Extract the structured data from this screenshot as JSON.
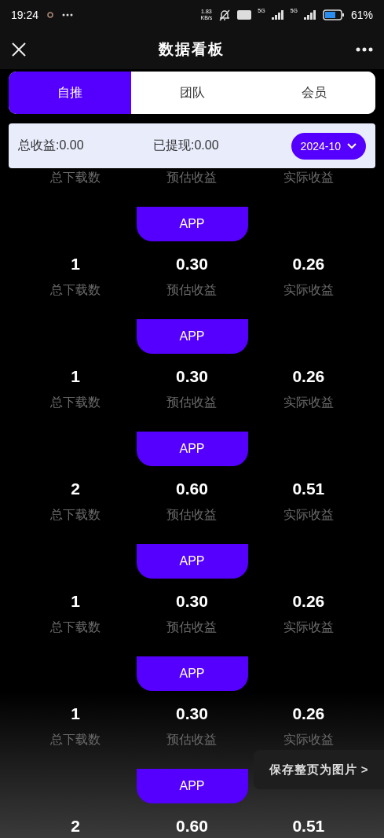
{
  "status_bar": {
    "time": "19:24",
    "speed": "1.83",
    "speed_unit": "KB/s",
    "network_1": "5G",
    "network_2": "5G",
    "battery": "61%"
  },
  "header": {
    "title": "数据看板"
  },
  "tabs": [
    {
      "label": "自推",
      "selected": true
    },
    {
      "label": "团队",
      "selected": false
    },
    {
      "label": "会员",
      "selected": false
    }
  ],
  "summary": {
    "total": "总收益:0.00",
    "withdrawn": "已提现:0.00",
    "month": "2024-10"
  },
  "records": [
    {
      "labels": [
        "总下载数",
        "预估收益",
        "实际收益"
      ]
    },
    {
      "app": "APP",
      "values": [
        "1",
        "0.30",
        "0.26"
      ],
      "labels": [
        "总下载数",
        "预估收益",
        "实际收益"
      ]
    },
    {
      "app": "APP",
      "values": [
        "1",
        "0.30",
        "0.26"
      ],
      "labels": [
        "总下载数",
        "预估收益",
        "实际收益"
      ]
    },
    {
      "app": "APP",
      "values": [
        "2",
        "0.60",
        "0.51"
      ],
      "labels": [
        "总下载数",
        "预估收益",
        "实际收益"
      ]
    },
    {
      "app": "APP",
      "values": [
        "1",
        "0.30",
        "0.26"
      ],
      "labels": [
        "总下载数",
        "预估收益",
        "实际收益"
      ]
    },
    {
      "app": "APP",
      "values": [
        "1",
        "0.30",
        "0.26"
      ],
      "labels": [
        "总下载数",
        "预估收益",
        "实际收益"
      ]
    },
    {
      "app": "APP",
      "values": [
        "2",
        "0.60",
        "0.51"
      ]
    }
  ],
  "save_button": {
    "label": "保存整页为图片 >"
  }
}
